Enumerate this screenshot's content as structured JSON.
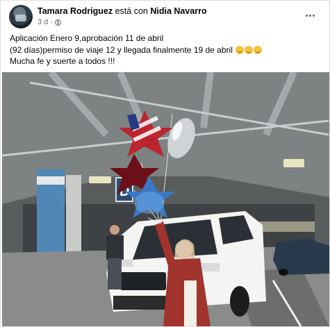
{
  "post": {
    "author": "Tamara Rodriguez",
    "with_text": "está con",
    "tagged": "Nidia Navarro",
    "time": "3 d",
    "separator": "·",
    "privacy_icon": "globe-icon",
    "lines": [
      "Aplicación Enero 9,aprobación 11 de abril",
      "(92 días)permiso de viaje 12 y llegada finalmente 19 de abril",
      "Mucha fe y suerte a todos !!!"
    ],
    "emoji_count": 3,
    "photo_sign": "D"
  },
  "colors": {
    "name_text": "#050505",
    "meta_text": "#65676b",
    "card_bg": "#ffffff",
    "page_bg": "#f0f2f5"
  }
}
